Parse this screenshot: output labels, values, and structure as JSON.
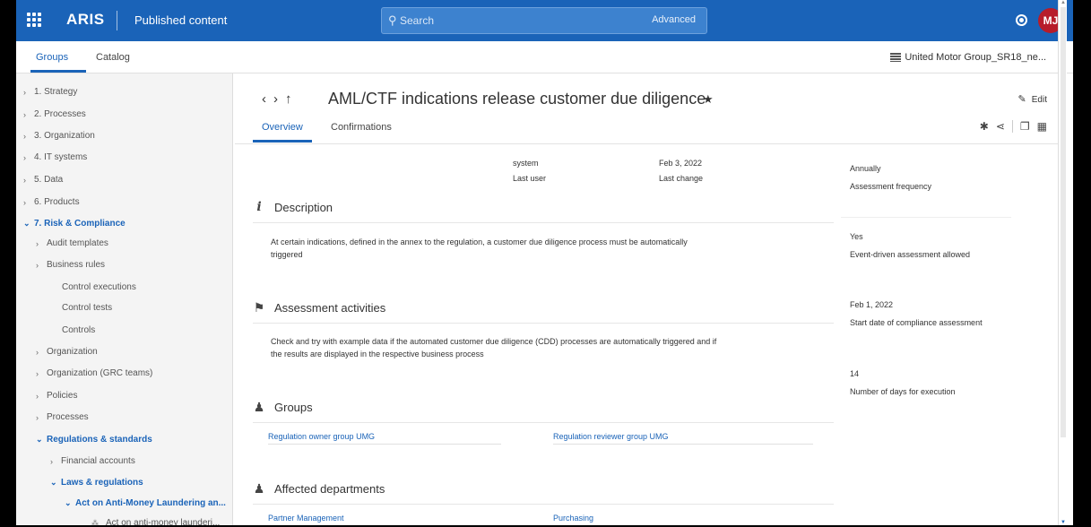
{
  "topbar": {
    "brand": "ARIS",
    "app_title": "Published content",
    "search_placeholder": "Search",
    "search_advanced": "Advanced",
    "avatar_initials": "MJ",
    "brand_color": "#1a63b8"
  },
  "subbar": {
    "tabs": [
      "Groups",
      "Catalog"
    ],
    "database": "United Motor Group_SR18_ne..."
  },
  "sidebar": {
    "items": [
      {
        "label": "1. Strategy",
        "chev": "›"
      },
      {
        "label": "2. Processes",
        "chev": "›"
      },
      {
        "label": "3. Organization",
        "chev": "›"
      },
      {
        "label": "4. IT systems",
        "chev": "›"
      },
      {
        "label": "5. Data",
        "chev": "›"
      },
      {
        "label": "6. Products",
        "chev": "›"
      },
      {
        "label": "7. Risk & Compliance",
        "chev": "⌄"
      },
      {
        "label": "Audit templates",
        "chev": "›"
      },
      {
        "label": "Business rules",
        "chev": "›"
      },
      {
        "label": "Control executions",
        "chev": ""
      },
      {
        "label": "Control tests",
        "chev": ""
      },
      {
        "label": "Controls",
        "chev": ""
      },
      {
        "label": "Organization",
        "chev": "›"
      },
      {
        "label": "Organization (GRC teams)",
        "chev": "›"
      },
      {
        "label": "Policies",
        "chev": "›"
      },
      {
        "label": "Processes",
        "chev": "›"
      },
      {
        "label": "Regulations & standards",
        "chev": "⌄"
      },
      {
        "label": "Financial accounts",
        "chev": "›"
      },
      {
        "label": "Laws & regulations",
        "chev": "⌄"
      },
      {
        "label": "Act on Anti-Money Laundering an...",
        "chev": "⌄"
      },
      {
        "label": "Act on anti-money launderi...",
        "chev": ""
      }
    ]
  },
  "main": {
    "title": "AML/CTF indications release customer due diligence",
    "edit_label": "Edit",
    "tabs": [
      "Overview",
      "Confirmations"
    ],
    "meta": {
      "user_value": "system",
      "user_label": "Last user",
      "change_value": "Feb 3, 2022",
      "change_label": "Last change"
    },
    "description": {
      "heading": "Description",
      "text": "At certain indications, defined in the annex to the regulation, a customer due diligence process must be automatically triggered"
    },
    "assessment": {
      "heading": "Assessment activities",
      "text": "Check and try with example data if the automated customer due diligence (CDD) processes are automatically triggered and if the results are displayed in the respective business process"
    },
    "groups": {
      "heading": "Groups",
      "links": [
        "Regulation owner group UMG",
        "Regulation reviewer group UMG"
      ]
    },
    "departments": {
      "heading": "Affected departments",
      "links": [
        "Partner Management",
        "Purchasing"
      ]
    }
  },
  "attributes": [
    {
      "value": "Annually",
      "label": "Assessment frequency"
    },
    {
      "value": "Yes",
      "label": "Event-driven assessment allowed"
    },
    {
      "value": "Feb 1, 2022",
      "label": "Start date of compliance assessment"
    },
    {
      "value": "14",
      "label": "Number of days for execution"
    }
  ]
}
